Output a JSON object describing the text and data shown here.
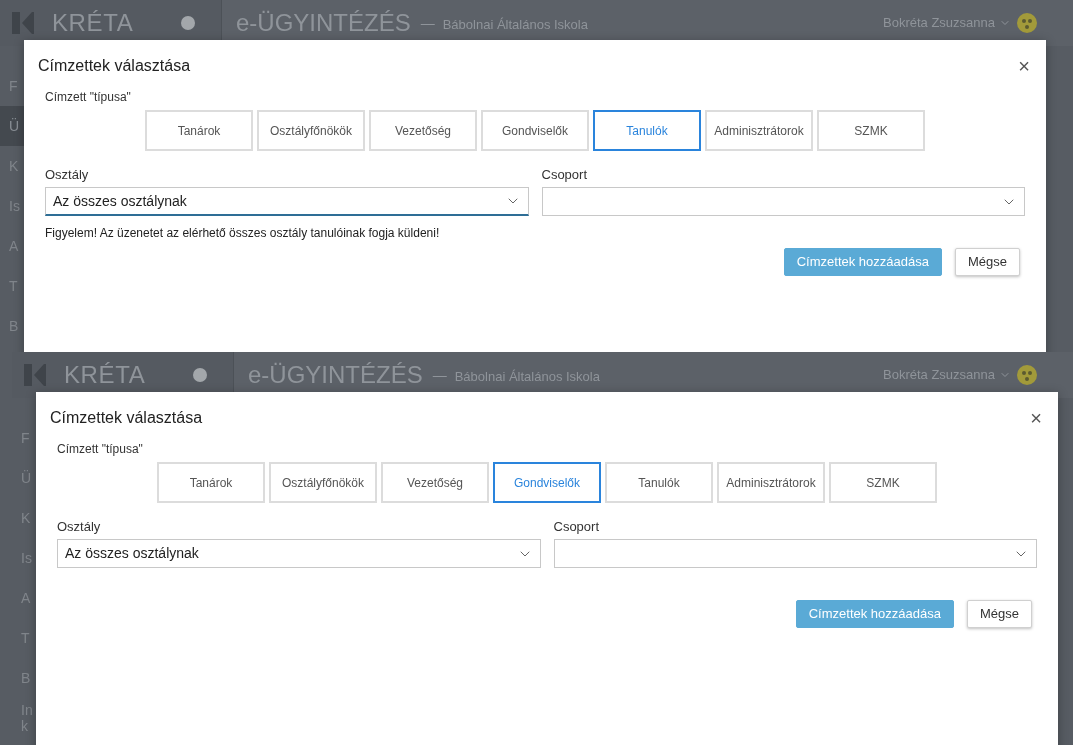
{
  "panels": [
    {
      "header": {
        "logo_text": "KRÉTA",
        "app_title": "e-ÜGYINTÉZÉS",
        "separator": "—",
        "school": "Bábolnai Általános Iskola",
        "user": "Bokréta Zsuzsanna"
      },
      "sidebar": {
        "items": [
          {
            "label": "F",
            "selected": false
          },
          {
            "label": "Ü",
            "selected": true
          },
          {
            "label": "K",
            "selected": false
          },
          {
            "label": "Is",
            "selected": false
          },
          {
            "label": "A",
            "selected": false
          },
          {
            "label": "T",
            "selected": false
          },
          {
            "label": "B",
            "selected": false
          }
        ]
      },
      "modal": {
        "title": "Címzettek választása",
        "close": "×",
        "type_label": "Címzett \"típusa\"",
        "types": [
          {
            "label": "Tanárok",
            "selected": false
          },
          {
            "label": "Osztályfőnökök",
            "selected": false
          },
          {
            "label": "Vezetőség",
            "selected": false
          },
          {
            "label": "Gondviselők",
            "selected": false
          },
          {
            "label": "Tanulók",
            "selected": true
          },
          {
            "label": "Adminisztrátorok",
            "selected": false
          },
          {
            "label": "SZMK",
            "selected": false
          }
        ],
        "class_label": "Osztály",
        "class_value": "Az összes osztálynak",
        "class_focused": true,
        "group_label": "Csoport",
        "warning": "Figyelem! Az üzenetet az elérhető összes osztály tanulóinak fogja küldeni!",
        "buttons": [
          {
            "label": "Címzettek hozzáadása",
            "kind": "primary"
          },
          {
            "label": "Mégse",
            "kind": "secondary"
          }
        ]
      }
    },
    {
      "header": {
        "logo_text": "KRÉTA",
        "app_title": "e-ÜGYINTÉZÉS",
        "separator": "—",
        "school": "Bábolnai Általános Iskola",
        "user": "Bokréta Zsuzsanna"
      },
      "sidebar": {
        "items": [
          {
            "label": "F",
            "selected": false
          },
          {
            "label": "Ü",
            "selected": false
          },
          {
            "label": "K",
            "selected": false
          },
          {
            "label": "Is",
            "selected": false
          },
          {
            "label": "A",
            "selected": false
          },
          {
            "label": "T",
            "selected": false
          },
          {
            "label": "B",
            "selected": false
          },
          {
            "label": "In k",
            "selected": false
          }
        ]
      },
      "modal": {
        "title": "Címzettek választása",
        "close": "×",
        "type_label": "Címzett \"típusa\"",
        "types": [
          {
            "label": "Tanárok",
            "selected": false
          },
          {
            "label": "Osztályfőnökök",
            "selected": false
          },
          {
            "label": "Vezetőség",
            "selected": false
          },
          {
            "label": "Gondviselők",
            "selected": true
          },
          {
            "label": "Tanulók",
            "selected": false
          },
          {
            "label": "Adminisztrátorok",
            "selected": false
          },
          {
            "label": "SZMK",
            "selected": false
          }
        ],
        "class_label": "Osztály",
        "class_value": "Az összes osztálynak",
        "class_focused": false,
        "group_label": "Csoport",
        "buttons": [
          {
            "label": "Címzettek hozzáadása",
            "kind": "primary"
          },
          {
            "label": "Mégse",
            "kind": "secondary"
          }
        ]
      }
    }
  ]
}
